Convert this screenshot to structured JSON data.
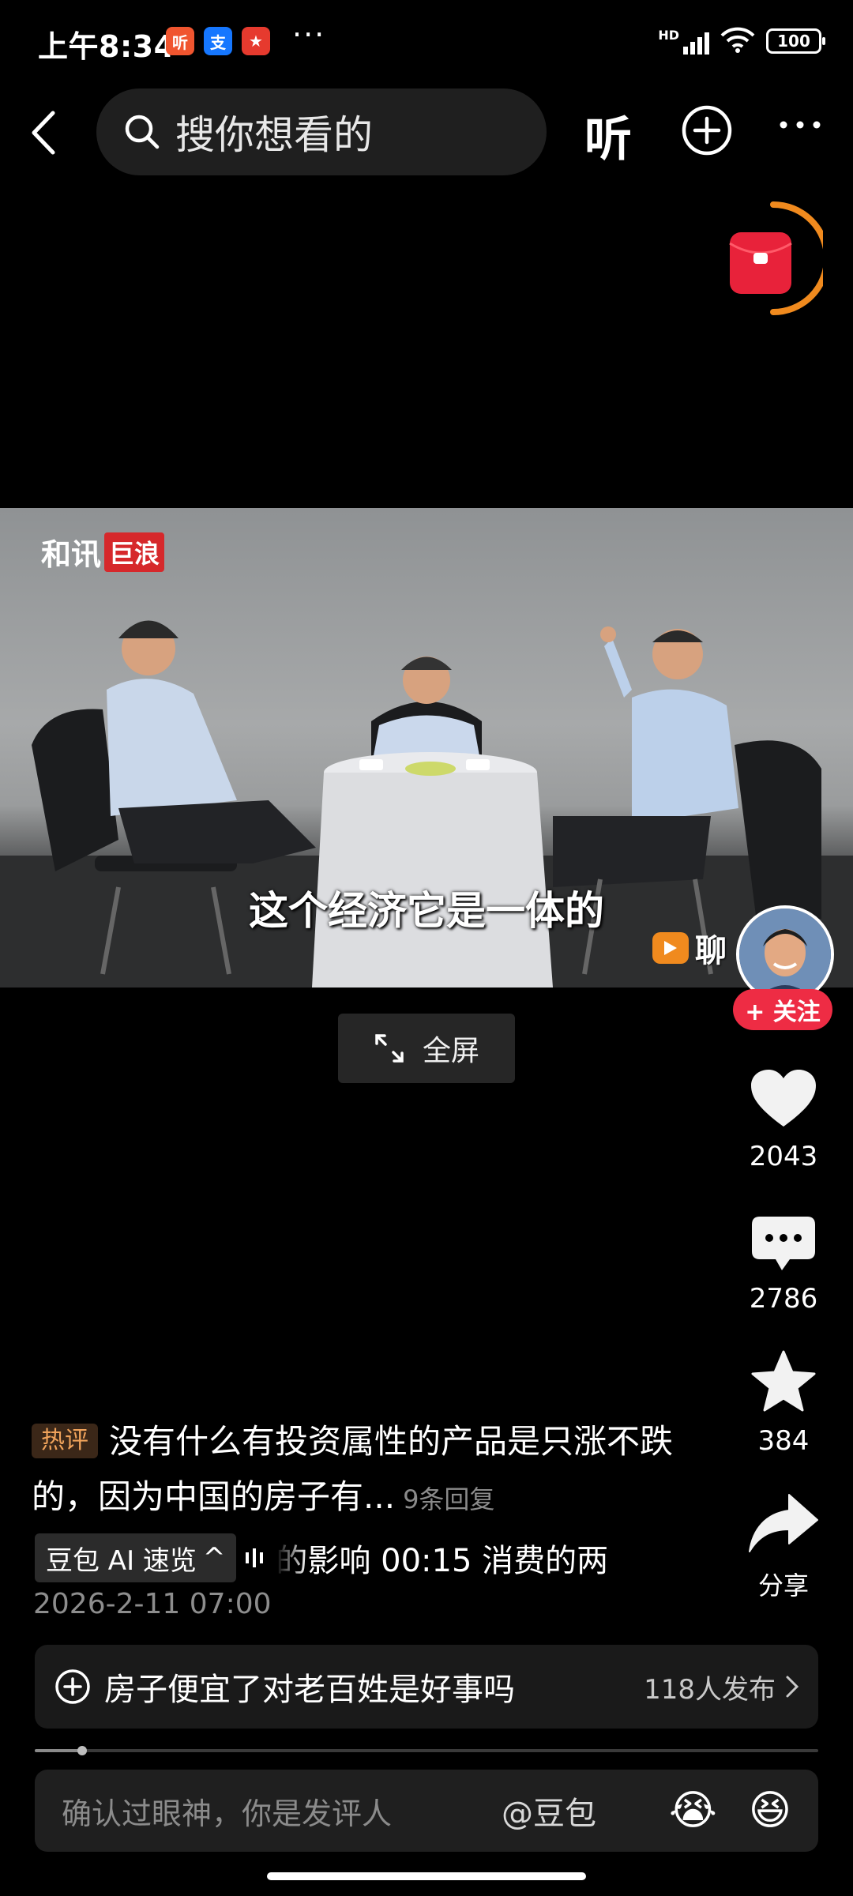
{
  "status_bar": {
    "time": "上午8:34",
    "app_icons": [
      {
        "name": "listen-app-icon",
        "glyph": "听",
        "color": "#f0552f"
      },
      {
        "name": "alipay-icon",
        "glyph": "支",
        "color": "#1677ff"
      },
      {
        "name": "red-app-icon",
        "glyph": "★",
        "color": "#e63a2e"
      }
    ],
    "more": "···",
    "signal": "HD",
    "battery": "100"
  },
  "top_bar": {
    "search_placeholder": "搜你想看的",
    "listen_label": "听"
  },
  "video": {
    "logo_main": "和讯",
    "logo_tag": "巨浪",
    "subtitle": "这个经济它是一体的",
    "watermark_text": "聊"
  },
  "fullscreen_label": "全屏",
  "right_rail": {
    "follow_label": "+ 关注",
    "likes": "2043",
    "comments": "2786",
    "favorites": "384",
    "share_label": "分享"
  },
  "hot_comment": {
    "badge": "热评",
    "text": "没有什么有投资属性的产品是只涨不跌的，因为中国的房子有...",
    "replies": "9条回复"
  },
  "ai_summary": {
    "chip_label": "豆包 AI 速览",
    "chip_icon": "^",
    "text": "的影响    00:15 消费的两"
  },
  "date": "2026-2-11 07:00",
  "topic": {
    "text": "房子便宜了对老百姓是好事吗",
    "count": "118人发布"
  },
  "playback": {
    "progress_fraction": 0.06
  },
  "comment_bar": {
    "placeholder": "确认过眼神，你是发评人",
    "mention": "@豆包",
    "emoji_1": "😭",
    "emoji_2": "😆"
  },
  "colors": {
    "accent_red": "#ee2c44",
    "badge_orange": "#f0a35b",
    "red_packet": "#e8223a",
    "timer_ring": "#f08a1e"
  }
}
